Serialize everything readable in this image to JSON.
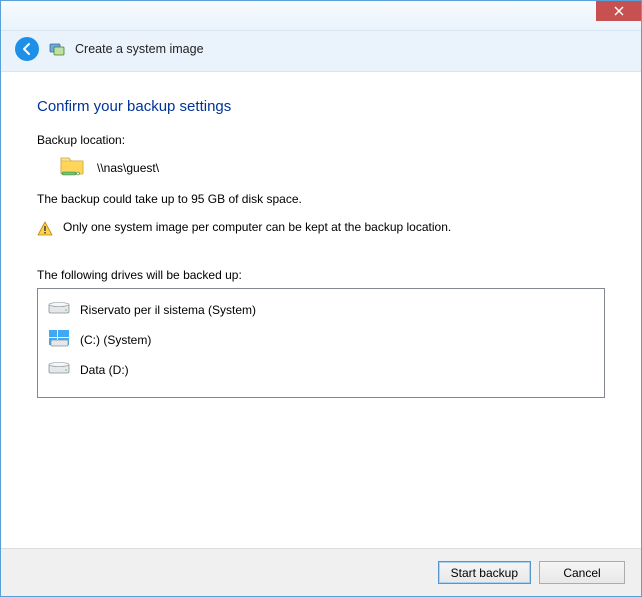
{
  "window": {
    "title": "Create a system image"
  },
  "page": {
    "heading": "Confirm your backup settings",
    "backupLocationLabel": "Backup location:",
    "backupLocationPath": "\\\\nas\\guest\\",
    "sizeEstimate": "The backup could take up to 95 GB of disk space.",
    "warning": "Only one system image per computer can be kept at the backup location.",
    "drivesLabel": "The following drives will be backed up:"
  },
  "drives": [
    {
      "name": "Riservato per il sistema (System)",
      "type": "hdd"
    },
    {
      "name": "(C:) (System)",
      "type": "os"
    },
    {
      "name": "Data (D:)",
      "type": "hdd"
    }
  ],
  "buttons": {
    "start": "Start backup",
    "cancel": "Cancel"
  }
}
